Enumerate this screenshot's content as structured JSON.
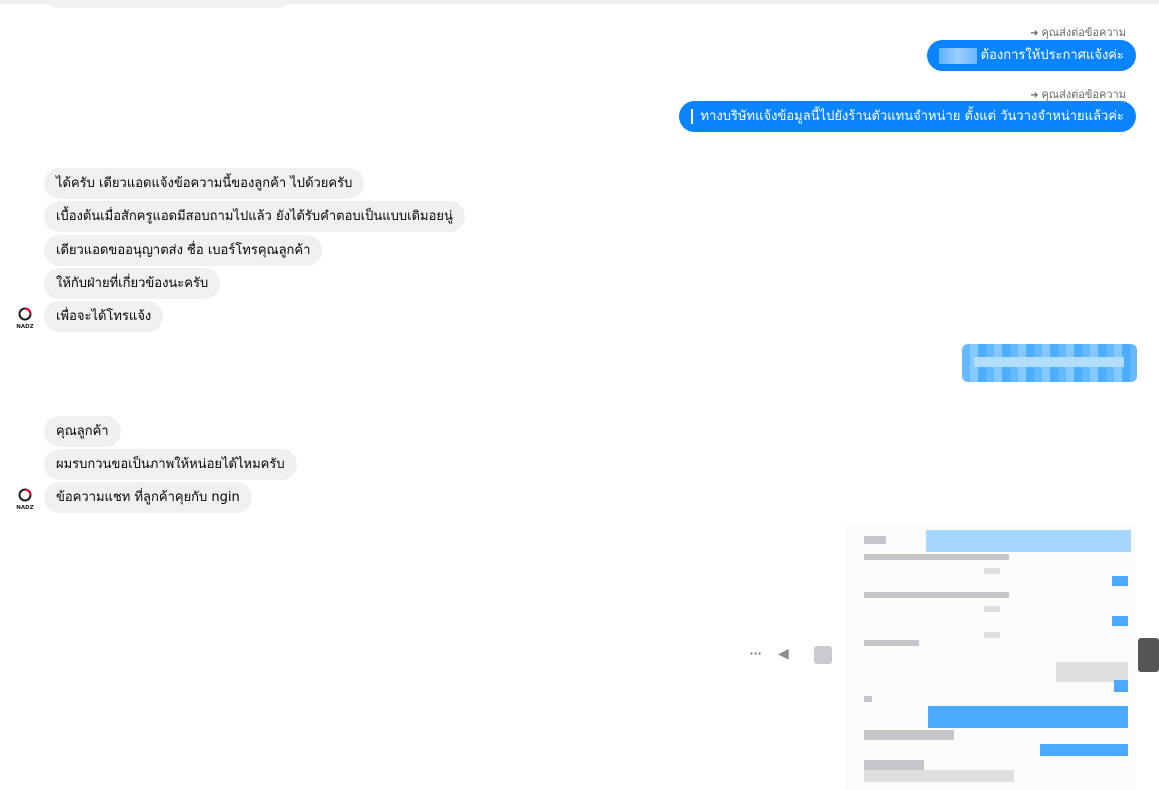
{
  "conversation": {
    "forwarded_label": "คุณส่งต่อข้อความ",
    "outgoing": [
      {
        "text": "ต้องการให้ประกาศแจ้งค่ะ"
      },
      {
        "text": "ทางบริษัทแจ้งข้อมูลนี้ไปยังร้านตัวแทนจำหน่าย ตั้งแต่ วันวางจำหน่ายแล้วค่ะ"
      }
    ],
    "incoming_group_1": [
      "ได้ครับ เดียวแอดแจ้งข้อความนี้ของลูกค้า ไปด้วยครับ",
      "เบื้องต้นเมื่อสักครูแอดมีสอบถามไปแล้ว ยังได้รับคำตอบเป็นแบบเดิมอยนู่",
      "เดียวแอดขออนุญาตส่ง ชื่อ เบอร์โทรคุณลูกค้า",
      "ให้กับฝ่ายที่เกี่ยวข้องนะครับ",
      "เพื่อจะได้โทรแจ้ง"
    ],
    "incoming_group_2": [
      "คุณลูกค้า",
      "ผมรบกวนขอเป็นภาพให้หน่อยได้ไหมครับ",
      "ข้อความแชท ที่ลูกค้าคุยกับ ngin"
    ]
  },
  "avatar": {
    "text": "NADZ"
  },
  "actions": {
    "more": "···",
    "reply": "◀"
  },
  "colors": {
    "outgoing_bubble": "#0a84ff",
    "incoming_bubble": "#f0f0f0",
    "meta_text": "#65676b"
  }
}
